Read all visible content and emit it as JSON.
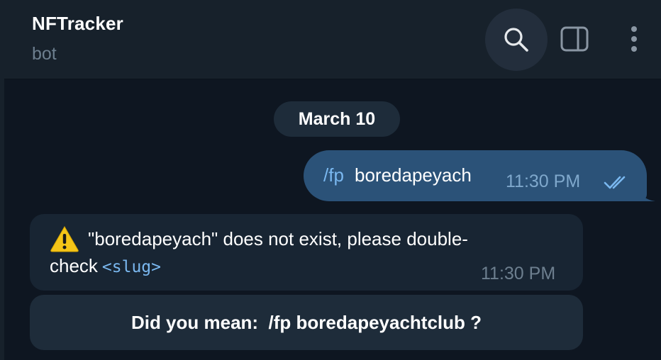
{
  "header": {
    "title": "NFTracker",
    "subtitle": "bot",
    "icons": [
      "search-icon",
      "sidebar-toggle-icon",
      "more-vertical-icon"
    ]
  },
  "date_separator": "March 10",
  "outgoing_message": {
    "command": "/fp",
    "text": " boredapeyach",
    "time": "11:30 PM",
    "status_icon": "double-check-icon"
  },
  "incoming_message": {
    "icon": "warning-icon",
    "line1": "\"boredapeyach\" does not exist, please double-",
    "line2": "check",
    "slug": "<slug>",
    "time": "11:30 PM"
  },
  "inline_button": {
    "label": "Did you mean:  /fp boredapeyachtclub ?"
  },
  "colors": {
    "background": "#0e1621",
    "header": "#17212b",
    "outgoing_bubble": "#2b5278",
    "incoming_bubble": "#182533",
    "accent": "#7ab8f0",
    "muted": "#6d7f8f"
  }
}
